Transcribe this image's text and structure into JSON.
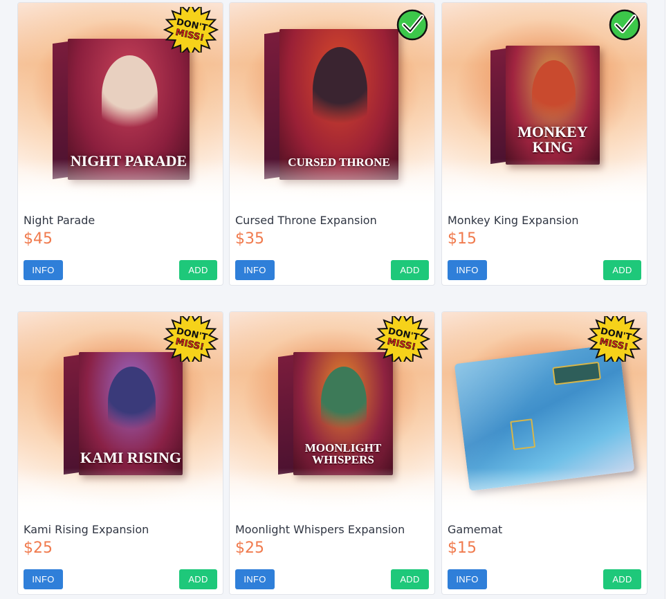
{
  "products": [
    {
      "title": "Night Parade",
      "price": "$45",
      "badge": "dont-miss",
      "box_title": "NIGHT PARADE",
      "info_label": "INFO",
      "add_label": "ADD",
      "palette": {
        "front": "#8c1f3e",
        "accent": "#c9435a",
        "figure": "#e8d0c0"
      }
    },
    {
      "title": "Cursed Throne Expansion",
      "price": "$35",
      "badge": "owned-check",
      "box_title": "CURSED THRONE",
      "info_label": "INFO",
      "add_label": "ADD",
      "palette": {
        "front": "#9a2036",
        "accent": "#d94a2a",
        "figure": "#3a2430"
      }
    },
    {
      "title": "Monkey King Expansion",
      "price": "$15",
      "badge": "owned-check",
      "box_title": "MONKEY KING",
      "info_label": "INFO",
      "add_label": "ADD",
      "palette": {
        "front": "#a02440",
        "accent": "#d8a04a",
        "figure": "#c94a2e"
      }
    },
    {
      "title": "Kami Rising Expansion",
      "price": "$25",
      "badge": "dont-miss",
      "box_title": "KAMI RISING",
      "info_label": "INFO",
      "add_label": "ADD",
      "palette": {
        "front": "#8a2146",
        "accent": "#9a6ac8",
        "figure": "#3a3a7a"
      }
    },
    {
      "title": "Moonlight Whispers Expansion",
      "price": "$25",
      "badge": "dont-miss",
      "box_title": "MOONLIGHT WHISPERS",
      "info_label": "INFO",
      "add_label": "ADD",
      "palette": {
        "front": "#8e2240",
        "accent": "#e88a2a",
        "figure": "#3d7a58"
      }
    },
    {
      "title": "Gamemat",
      "price": "$15",
      "badge": "dont-miss",
      "box_title": "",
      "info_label": "INFO",
      "add_label": "ADD",
      "palette": {
        "front": "#4a9ad2",
        "accent": "#d7b64a",
        "figure": "#2e5e5a"
      }
    }
  ],
  "badges": {
    "dont_miss_text_1": "DON'T",
    "dont_miss_text_2": "MISS!"
  },
  "colors": {
    "price": "#f07a4d",
    "info_button": "#2f7fd9",
    "add_button": "#1ec87a",
    "check_green": "#3cc74a"
  }
}
